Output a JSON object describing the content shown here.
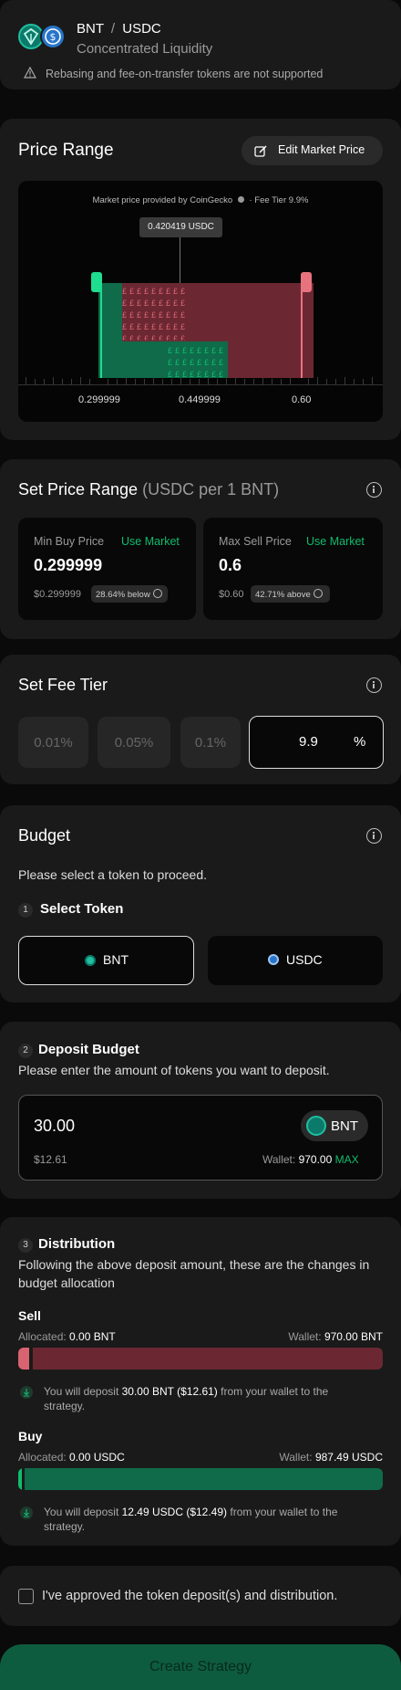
{
  "header": {
    "token_a": "BNT",
    "separator": "/",
    "token_b": "USDC",
    "strategy_type": "Concentrated Liquidity",
    "warning": "Rebasing and fee-on-transfer tokens are not supported"
  },
  "price_range": {
    "title": "Price Range",
    "edit_button": "Edit Market Price",
    "provider_note": "Market price provided by CoinGecko",
    "fee_tier_note": "· Fee Tier 9.9%",
    "market_price_label": "0.420419 USDC",
    "tick_min": "0.299999",
    "tick_mid": "0.449999",
    "tick_max": "0.60"
  },
  "set_price_range": {
    "title": "Set Price Range",
    "unit": "(USDC per 1 BNT)",
    "min": {
      "label": "Min Buy Price",
      "use_market": "Use Market",
      "value": "0.299999",
      "usd": "$0.299999",
      "badge": "28.64% below"
    },
    "max": {
      "label": "Max Sell Price",
      "use_market": "Use Market",
      "value": "0.6",
      "usd": "$0.60",
      "badge": "42.71% above"
    }
  },
  "fee_tier": {
    "title": "Set Fee Tier",
    "options": [
      "0.01%",
      "0.05%",
      "0.1%"
    ],
    "custom_value": "9.9",
    "custom_unit": "%"
  },
  "budget": {
    "title": "Budget",
    "hint": "Please select a token to proceed.",
    "step1_num": "1",
    "step1_title": "Select Token",
    "token_a": "BNT",
    "token_b": "USDC",
    "selected": "BNT"
  },
  "deposit": {
    "step_num": "2",
    "title": "Deposit Budget",
    "hint": "Please enter the amount of tokens you want to deposit.",
    "amount": "30.00",
    "token": "BNT",
    "usd": "$12.61",
    "wallet_label": "Wallet:",
    "wallet_value": "970.00",
    "max_label": "MAX"
  },
  "distribution": {
    "step_num": "3",
    "title": "Distribution",
    "hint_line1": "Following the above deposit amount, these are the changes in",
    "hint_line2": "budget allocation",
    "sell": {
      "title": "Sell",
      "allocated_label": "Allocated:",
      "allocated_value": "0.00 BNT",
      "wallet_label": "Wallet:",
      "wallet_value": "970.00 BNT",
      "allocation_fraction": 0.03,
      "note_pre": "You will deposit",
      "note_amount": "30.00 BNT ($12.61)",
      "note_post": "from your wallet to the",
      "note_line2": "strategy."
    },
    "buy": {
      "title": "Buy",
      "allocated_label": "Allocated:",
      "allocated_value": "0.00 USDC",
      "wallet_label": "Wallet:",
      "wallet_value": "987.49 USDC",
      "allocation_fraction": 0.01,
      "note_pre": "You will deposit",
      "note_amount": "12.49 USDC ($12.49)",
      "note_post": "from your wallet to the",
      "note_line2": "strategy."
    }
  },
  "approval": {
    "label": "I've approved the token deposit(s) and distribution.",
    "checked": false
  },
  "submit_button": "Create Strategy",
  "colors": {
    "accent_green": "#10bb6d",
    "sell_red": "#d86371",
    "buy_green": "#0f6b4a",
    "background": "#0a0a0a",
    "card": "#1a1a1a"
  }
}
